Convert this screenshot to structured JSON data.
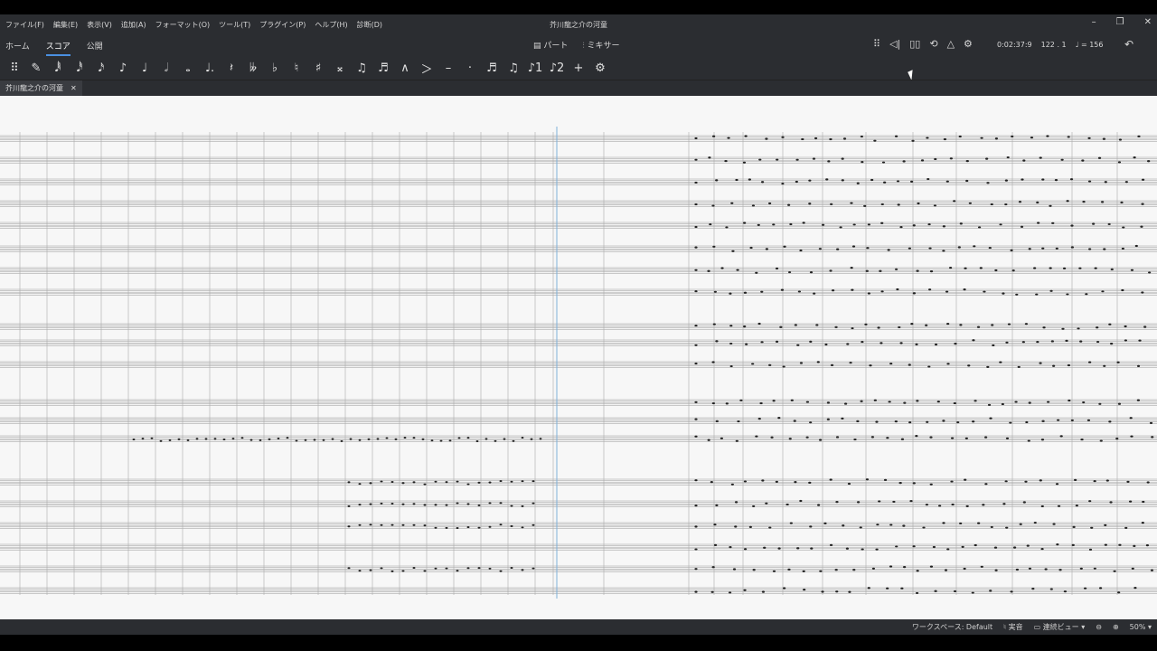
{
  "menu": [
    "ファイル(F)",
    "編集(E)",
    "表示(V)",
    "追加(A)",
    "フォーマット(O)",
    "ツール(T)",
    "プラグイン(P)",
    "ヘルプ(H)",
    "診断(D)"
  ],
  "window_title": "芥川龍之介の河童",
  "window_buttons": [
    "–",
    "❐",
    "✕"
  ],
  "tabs": [
    "ホーム",
    "スコア",
    "公開"
  ],
  "center_buttons": {
    "parts": "パート",
    "mixer": "ミキサー"
  },
  "right_tools": [
    "⠿",
    "◁|",
    "▯▯",
    "⟲",
    "△",
    "⚙"
  ],
  "playback": {
    "time": "0:02:37:9",
    "position": "122 . 1",
    "tempo": "♩ = 156"
  },
  "palette": [
    "⠿",
    "✎",
    "𝅘𝅥𝅱",
    "𝅘𝅥𝅰",
    "𝅘𝅥𝅯",
    "♪",
    "♩",
    "𝅗𝅥",
    "𝅝",
    "♩.",
    "𝄽",
    "𝄫",
    "♭",
    "♮",
    "♯",
    "𝄪",
    "♫",
    "♬",
    "∧",
    "＞",
    "–",
    "·",
    "♬",
    "♫",
    "♪1",
    "♪2",
    "+",
    "⚙"
  ],
  "document_tab": {
    "label": "芥川龍之介の河童",
    "close": "✕"
  },
  "statusbar": {
    "workspace": "ワークスペース: Default",
    "concert_pitch": "実音",
    "view_mode": "連続ビュー",
    "zoom": "50%"
  }
}
